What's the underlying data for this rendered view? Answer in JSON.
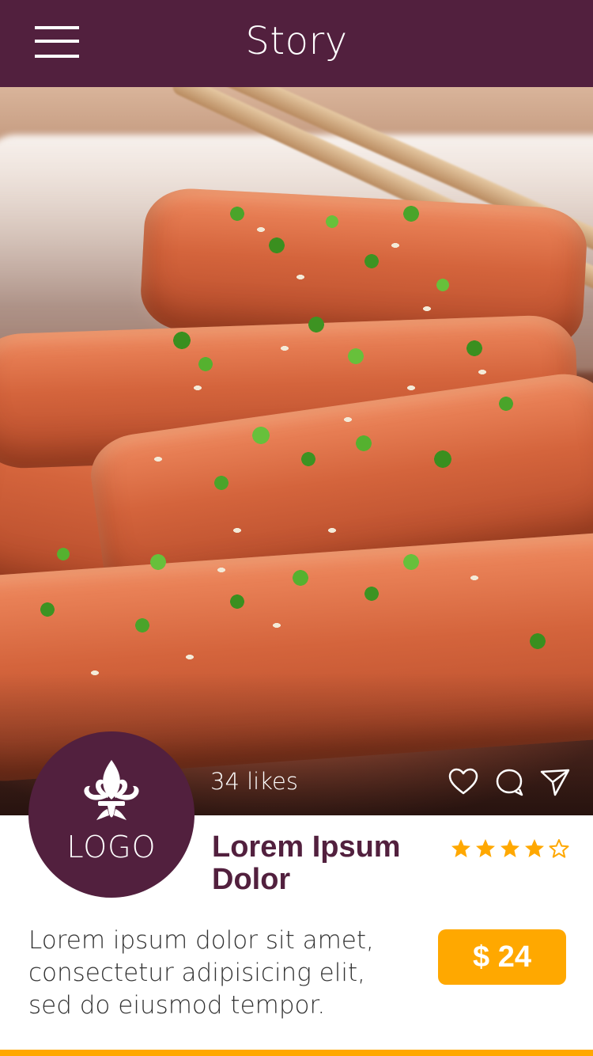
{
  "header": {
    "title": "Story"
  },
  "post": {
    "likes": "34 likes",
    "logo_text": "LOGO",
    "title": "Lorem Ipsum Dolor",
    "rating": 4,
    "rating_max": 5,
    "description": "Lorem ipsum dolor sit amet, consectetur adipisicing elit, sed do eiusmod tempor.",
    "price": "$ 24"
  },
  "icons": {
    "menu": "hamburger-menu-icon",
    "like": "heart-icon",
    "comment": "comment-bubble-icon",
    "share": "send-icon",
    "logo": "fleur-de-lis-icon",
    "star_full": "star-filled-icon",
    "star_empty": "star-outline-icon"
  },
  "colors": {
    "brand": "#52203e",
    "accent": "#ffa800",
    "text": "#333333",
    "white": "#ffffff"
  }
}
